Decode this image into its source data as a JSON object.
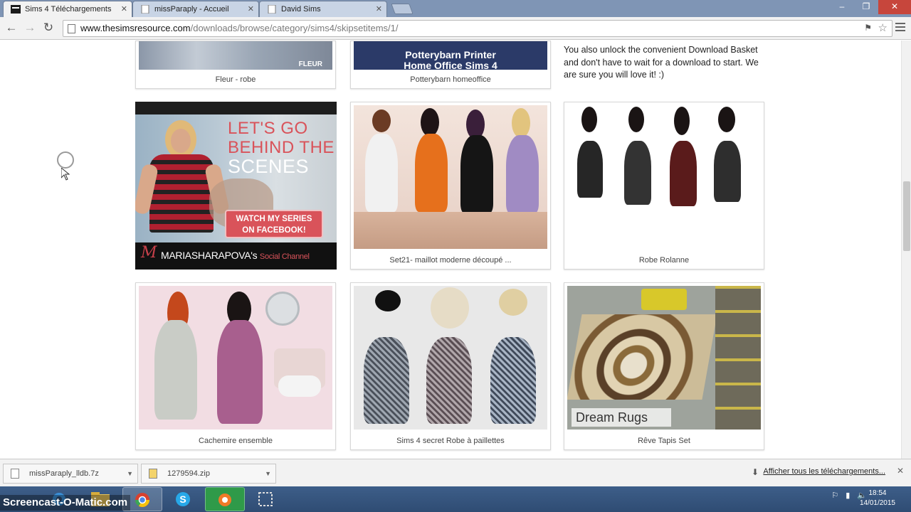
{
  "tabs": [
    {
      "label": "Sims 4 Téléchargements",
      "active": true
    },
    {
      "label": "missParaply - Accueil",
      "active": false
    },
    {
      "label": "David Sims",
      "active": false
    }
  ],
  "address": {
    "host": "www.thesimsresource.com",
    "path": "/downloads/browse/category/sims4/skipsetitems/1/"
  },
  "page": {
    "intro_text": "You also unlock the convenient Download Basket and don't have to wait for a download to start. We are sure you will love it! :)",
    "top_cards": [
      {
        "caption": "Fleur - robe",
        "thumb_text": "FLEUR"
      },
      {
        "caption": "Potterybarn homeoffice",
        "thumb_line1": "Potterybarn Printer",
        "thumb_line2": "Home Office Sims 4"
      }
    ],
    "ad": {
      "headline_1": "LET'S GO",
      "headline_2": "BEHIND THE",
      "headline_3": "SCENES",
      "button_line1": "WATCH MY SERIES",
      "button_line2": "ON FACEBOOK!",
      "signature": "M",
      "brand_name": "MARIASHARAPOVA's",
      "brand_suffix": "Social Channel"
    },
    "items": [
      {
        "caption": "Set21- maillot moderne découpé ..."
      },
      {
        "caption": "Robe Rolanne"
      },
      {
        "caption": "Cachemire ensemble"
      },
      {
        "caption": "Sims 4 secret Robe à paillettes"
      },
      {
        "caption": "Rêve Tapis Set",
        "thumb_text": "Dream Rugs"
      }
    ]
  },
  "downloads": {
    "items": [
      {
        "name": "missParaply_lldb.7z"
      },
      {
        "name": "1279594.zip"
      }
    ],
    "show_all": "Afficher tous les téléchargements..."
  },
  "taskbar": {
    "time": "18:54",
    "date": "14/01/2015"
  },
  "watermark": "Screencast-O-Matic.com",
  "colors": {
    "tabstrip": "#7f95b5",
    "ad_accent": "#d9535a",
    "taskbar": "#2f4c73"
  }
}
